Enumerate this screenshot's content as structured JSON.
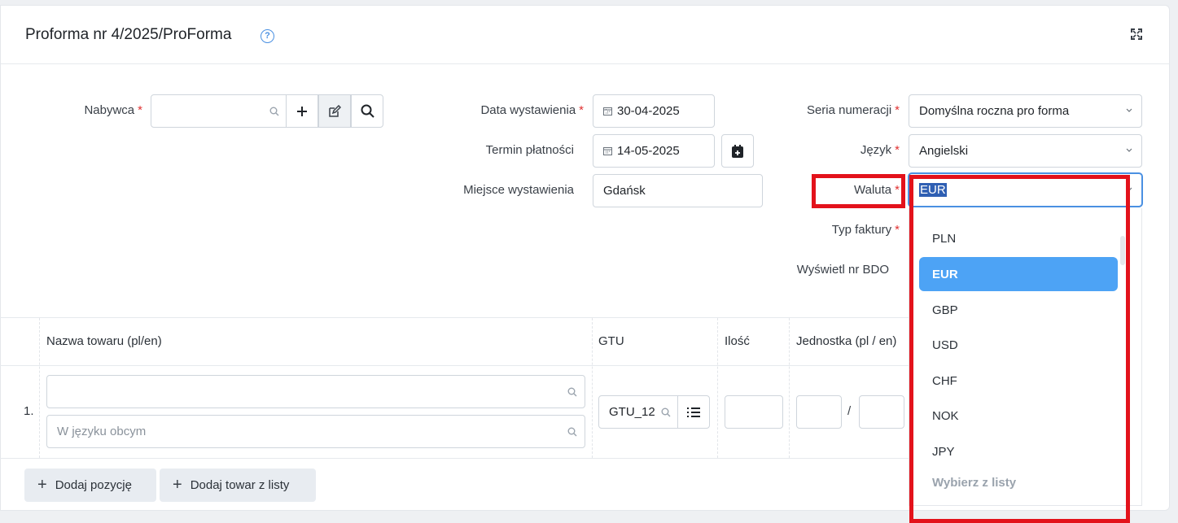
{
  "header": {
    "title": "Proforma nr 4/2025/ProForma",
    "help": "?"
  },
  "form": {
    "buyer": {
      "label": "Nabywca",
      "required": "*"
    },
    "issue_date": {
      "label": "Data wystawienia",
      "required": "*",
      "value": "30-04-2025"
    },
    "payment_term": {
      "label": "Termin płatności",
      "value": "14-05-2025"
    },
    "place": {
      "label": "Miejsce wystawienia",
      "value": "Gdańsk"
    },
    "numbering": {
      "label": "Seria numeracji",
      "required": "*",
      "value": "Domyślna roczna pro forma"
    },
    "language": {
      "label": "Język",
      "required": "*",
      "value": "Angielski"
    },
    "currency": {
      "label": "Waluta",
      "required": "*",
      "value": "EUR"
    },
    "invoice_type": {
      "label": "Typ faktury",
      "required": "*"
    },
    "bdo": {
      "label": "Wyświetl nr BDO"
    }
  },
  "currency_dropdown": {
    "options": [
      "PLN",
      "EUR",
      "GBP",
      "USD",
      "CHF",
      "NOK",
      "JPY"
    ],
    "selected": "EUR",
    "more": "Wybierz z listy"
  },
  "table": {
    "headers": {
      "name": "Nazwa towaru (pl/en)",
      "gtu": "GTU",
      "qty": "Ilość",
      "unit": "Jednostka (pl / en)"
    },
    "row": {
      "index": "1.",
      "foreign_placeholder": "W języku obcym",
      "gtu_value": "GTU_12",
      "unit_sep": "/"
    }
  },
  "actions": {
    "add_position": "Dodaj pozycję",
    "add_from_list": "Dodaj towar z listy"
  }
}
